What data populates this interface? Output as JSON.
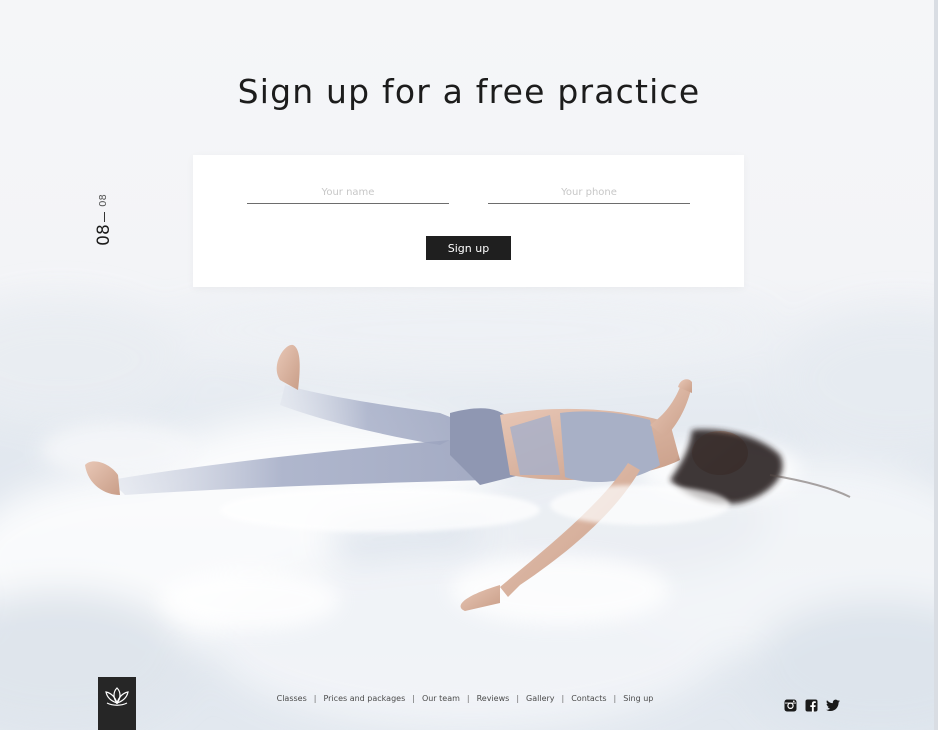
{
  "header": {
    "title": "Sign up for a free practice"
  },
  "slide_counter": {
    "current": "08",
    "total": "08"
  },
  "form": {
    "name_placeholder": "Your name",
    "phone_placeholder": "Your phone",
    "submit_label": "Sign up"
  },
  "footer": {
    "nav": [
      {
        "label": "Classes"
      },
      {
        "label": "Prices and packages"
      },
      {
        "label": "Our team"
      },
      {
        "label": "Reviews"
      },
      {
        "label": "Gallery"
      },
      {
        "label": "Contacts"
      },
      {
        "label": "Sing up"
      }
    ],
    "separator": "|",
    "social_icons": [
      "instagram-icon",
      "facebook-icon",
      "twitter-icon"
    ]
  },
  "colors": {
    "text_dark": "#1c1c1c",
    "button_bg": "#1f1f1f",
    "logo_bg": "#262626",
    "card_bg": "#ffffff"
  }
}
